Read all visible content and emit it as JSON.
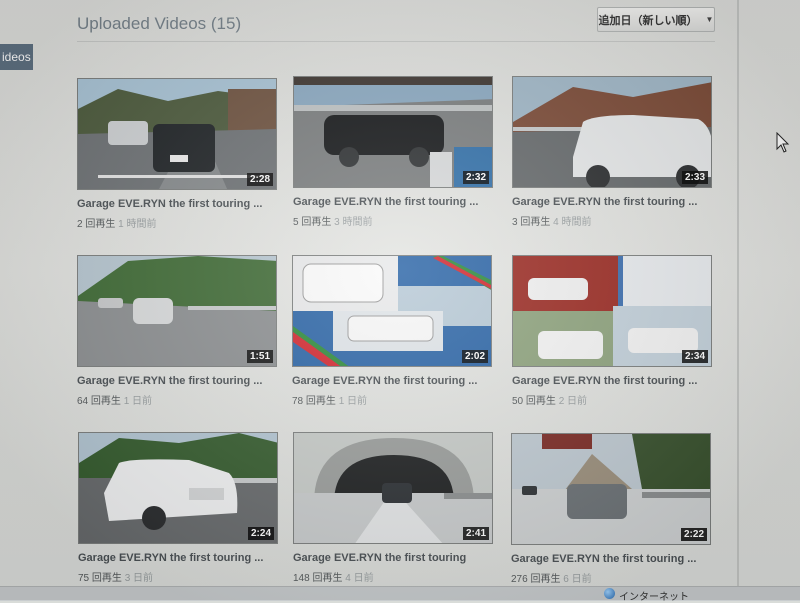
{
  "sidebar": {
    "active_tab_label": "ideos"
  },
  "header": {
    "title": "Uploaded Videos (15)",
    "sort_label": "追加日（新しい順）"
  },
  "videos": [
    {
      "title": "Garage EVE.RYN the first touring ...",
      "views": "2 回再生",
      "age": "1 時間前",
      "duration": "2:28"
    },
    {
      "title": "Garage EVE.RYN the first touring ...",
      "views": "5 回再生",
      "age": "3 時間前",
      "duration": "2:32"
    },
    {
      "title": "Garage EVE.RYN the first touring ...",
      "views": "3 回再生",
      "age": "4 時間前",
      "duration": "2:33"
    },
    {
      "title": "Garage EVE.RYN the first touring ...",
      "views": "64 回再生",
      "age": "1 日前",
      "duration": "1:51"
    },
    {
      "title": "Garage EVE.RYN the first touring ...",
      "views": "78 回再生",
      "age": "1 日前",
      "duration": "2:02"
    },
    {
      "title": "Garage EVE.RYN the first touring ...",
      "views": "50 回再生",
      "age": "2 日前",
      "duration": "2:34"
    },
    {
      "title": "Garage EVE.RYN the first touring ...",
      "views": "75 回再生",
      "age": "3 日前",
      "duration": "2:24"
    },
    {
      "title": "Garage EVE.RYN the first touring",
      "views": "148 回再生",
      "age": "4 日前",
      "duration": "2:41"
    },
    {
      "title": "Garage EVE.RYN the first touring ...",
      "views": "276 回再生",
      "age": "6 日前",
      "duration": "2:22"
    }
  ],
  "statusbar": {
    "zone_label": "インターネット"
  },
  "icons": {
    "sort_caret": "chevron-down-icon",
    "cursor": "mouse-pointer-icon",
    "zone": "globe-icon"
  }
}
